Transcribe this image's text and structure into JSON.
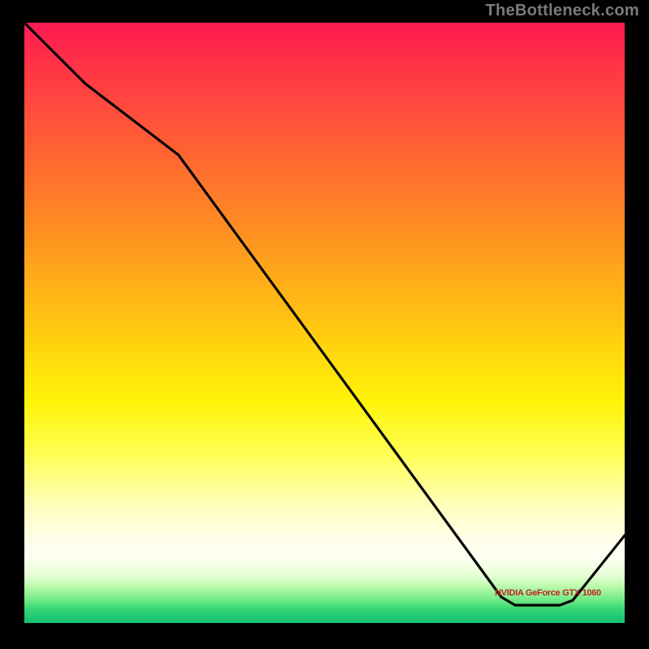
{
  "watermark": "TheBottleneck.com",
  "chart_data": {
    "type": "line",
    "title": "",
    "xlabel": "",
    "ylabel": "",
    "xlim": [
      0,
      100
    ],
    "ylim": [
      0,
      100
    ],
    "x": [
      0,
      10,
      26,
      80,
      82,
      89,
      91,
      100
    ],
    "values": [
      100,
      90,
      78,
      4,
      3,
      3,
      4,
      15
    ],
    "annotations": [
      {
        "text": "NVIDIA GeForce GTX 1060",
        "x": 85,
        "y": 5
      }
    ],
    "gradient_stops": [
      {
        "pos": 0.0,
        "color": "#ff1a52"
      },
      {
        "pos": 0.24,
        "color": "#ff6b2f"
      },
      {
        "pos": 0.54,
        "color": "#ffd40e"
      },
      {
        "pos": 0.8,
        "color": "#ffffb8"
      },
      {
        "pos": 0.92,
        "color": "#e7ffd6"
      },
      {
        "pos": 1.0,
        "color": "#14c06f"
      }
    ]
  }
}
